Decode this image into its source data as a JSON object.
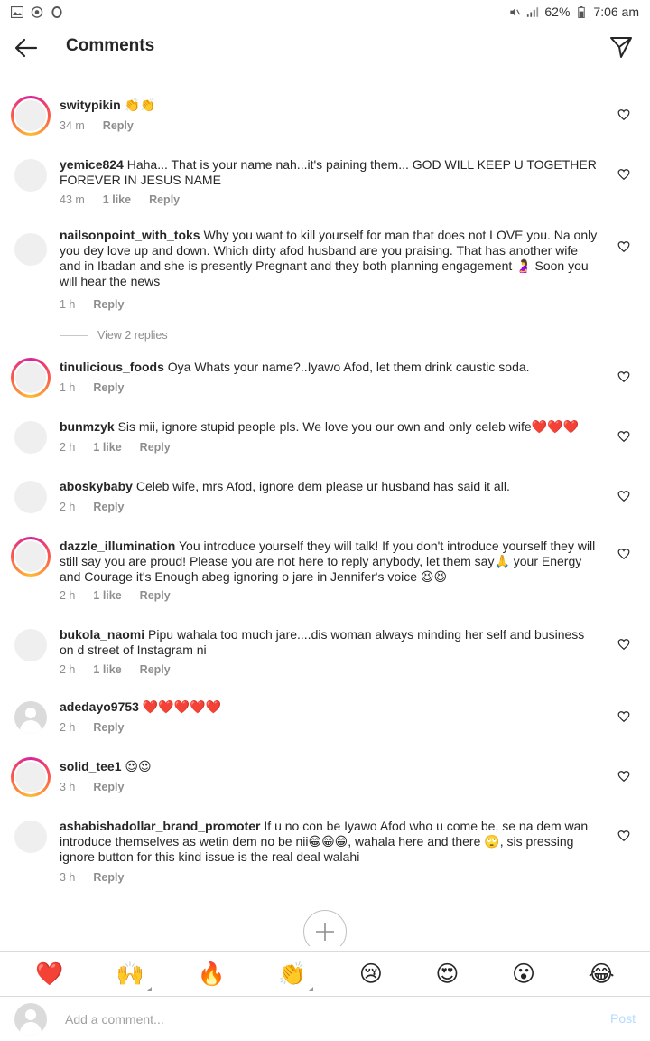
{
  "status_bar": {
    "battery": "62%",
    "time": "7:06 am"
  },
  "header": {
    "title": "Comments"
  },
  "comments": [
    {
      "username": "switypikin",
      "text": "👏👏",
      "time": "34 m",
      "likes": "",
      "reply": "Reply"
    },
    {
      "username": "yemice824",
      "text": "Haha... That is your name nah...it's paining them... GOD WILL KEEP U TOGETHER FOREVER IN JESUS NAME",
      "time": "43 m",
      "likes": "1 like",
      "reply": "Reply"
    },
    {
      "username": "nailsonpoint_with_toks",
      "text": "Why you want to kill yourself for man that does not LOVE you. Na only you dey love up and down. Which dirty afod husband are you praising. That has another wife and in Ibadan and she is presently Pregnant and they both planning engagement 🤰 Soon you will hear the news",
      "time": "1 h",
      "likes": "",
      "reply": "Reply",
      "view_replies": "View 2 replies"
    },
    {
      "username": "tinulicious_foods",
      "text": "Oya Whats your name?..Iyawo Afod, let them drink caustic soda.",
      "time": "1 h",
      "likes": "",
      "reply": "Reply"
    },
    {
      "username": "bunmzyk",
      "text": "Sis mii, ignore stupid people pls. We love you our own and only celeb wife❤️❤️❤️",
      "time": "2 h",
      "likes": "1 like",
      "reply": "Reply"
    },
    {
      "username": "aboskybaby",
      "text": "Celeb wife, mrs Afod, ignore dem please ur husband has said it all.",
      "time": "2 h",
      "likes": "",
      "reply": "Reply"
    },
    {
      "username": "dazzle_illumination",
      "text": "You introduce yourself they will talk! If you don't introduce yourself they will still say you are proud! Please you are not here to reply anybody, let them say🙏 your Energy and Courage it's Enough abeg ignoring o jare in Jennifer's voice 😆😆",
      "time": "2 h",
      "likes": "1 like",
      "reply": "Reply"
    },
    {
      "username": "bukola_naomi",
      "text": "Pipu wahala too much jare....dis woman always minding her self and business on d street of Instagram ni",
      "time": "2 h",
      "likes": "1 like",
      "reply": "Reply"
    },
    {
      "username": "adedayo9753",
      "text": "❤️❤️❤️❤️❤️",
      "time": "2 h",
      "likes": "",
      "reply": "Reply"
    },
    {
      "username": "solid_tee1",
      "text": "😍😍",
      "time": "3 h",
      "likes": "",
      "reply": "Reply"
    },
    {
      "username": "ashabishadollar_brand_promoter",
      "text": "If u no con be Iyawo Afod who u come be, se na dem wan introduce themselves as wetin dem no be nii😁😁😁, wahala here and there 🙄, sis pressing ignore button for this kind issue is the real deal walahi",
      "time": "3 h",
      "likes": "",
      "reply": "Reply"
    }
  ],
  "emoji_bar": [
    "❤️",
    "🙌",
    "🔥",
    "👏",
    "😢",
    "😍",
    "😮",
    "😂"
  ],
  "composer": {
    "placeholder": "Add a comment...",
    "post_label": "Post"
  }
}
